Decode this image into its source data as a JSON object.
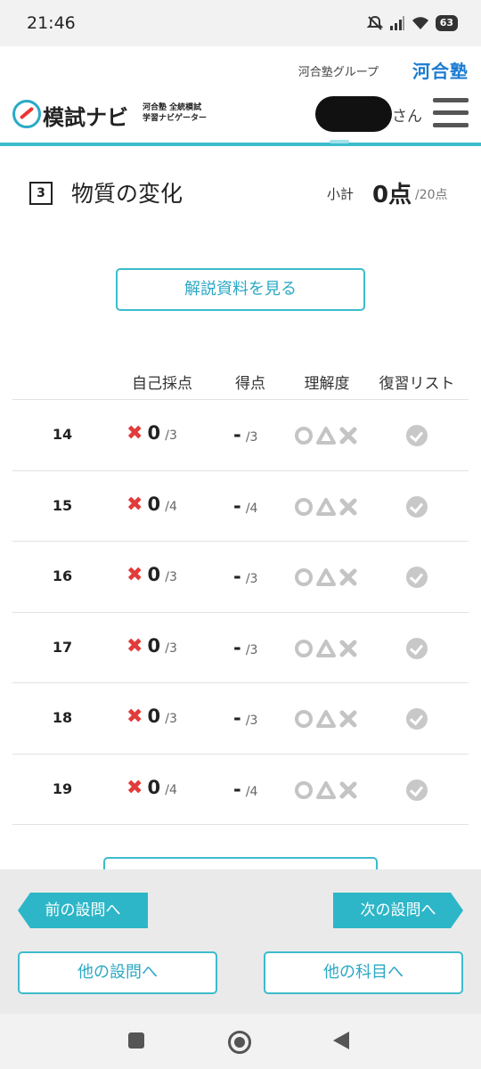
{
  "status_bar": {
    "time": "21:46",
    "battery": "63"
  },
  "group_bar": {
    "group_text": "河合塾グループ",
    "logo_text": "河合塾"
  },
  "header": {
    "app_title": "模試ナビ",
    "app_subtitle_line1": "河合塾 全統模試",
    "app_subtitle_line2": "学習ナビゲーター",
    "user_suffix": "さん"
  },
  "section": {
    "number": "3",
    "title": "物質の変化",
    "subtotal_label": "小計",
    "subtotal_score": "0点",
    "subtotal_total": "/20点"
  },
  "explain_button": "解説資料を見る",
  "table": {
    "headers": [
      "自己採点",
      "得点",
      "理解度",
      "復習リスト"
    ],
    "rows": [
      {
        "num": "14",
        "self_score": "0",
        "self_max": "/3",
        "score": "-",
        "score_max": "/3"
      },
      {
        "num": "15",
        "self_score": "0",
        "self_max": "/4",
        "score": "-",
        "score_max": "/4"
      },
      {
        "num": "16",
        "self_score": "0",
        "self_max": "/3",
        "score": "-",
        "score_max": "/3"
      },
      {
        "num": "17",
        "self_score": "0",
        "self_max": "/3",
        "score": "-",
        "score_max": "/3"
      },
      {
        "num": "18",
        "self_score": "0",
        "self_max": "/3",
        "score": "-",
        "score_max": "/3"
      },
      {
        "num": "19",
        "self_score": "0",
        "self_max": "/4",
        "score": "-",
        "score_max": "/4"
      }
    ]
  },
  "footer_nav": {
    "prev": "前の設問へ",
    "next": "次の設問へ",
    "other_question": "他の設問へ",
    "other_subject": "他の科目へ"
  },
  "colors": {
    "accent": "#2db6c8",
    "wrong": "#e23b3b",
    "brand_blue": "#1b7bd1"
  },
  "icons": [
    "mute-icon",
    "signal-icon",
    "wifi-icon",
    "battery-icon",
    "menu-icon",
    "cross-icon",
    "circle-icon",
    "triangle-icon",
    "check-icon"
  ]
}
